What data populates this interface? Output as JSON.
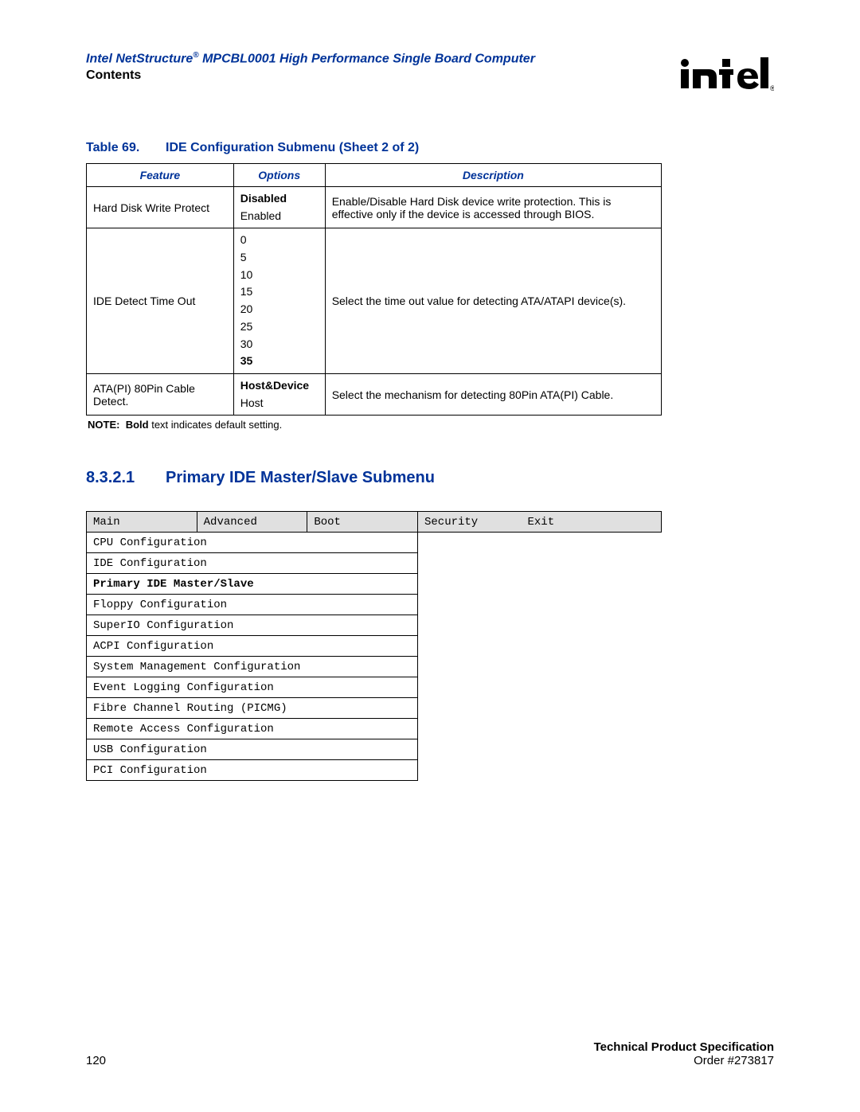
{
  "header": {
    "doc_title_prefix": "Intel NetStructure",
    "doc_title_suffix": " MPCBL0001 High Performance Single Board Computer",
    "contents_label": "Contents"
  },
  "table69": {
    "label": "Table 69.",
    "title": "IDE Configuration Submenu (Sheet 2 of 2)",
    "headers": {
      "feature": "Feature",
      "options": "Options",
      "description": "Description"
    },
    "rows": [
      {
        "feature": "Hard Disk Write Protect",
        "options": [
          {
            "text": "Disabled",
            "bold": true
          },
          {
            "text": "Enabled",
            "bold": false
          }
        ],
        "description": "Enable/Disable Hard Disk device write protection. This is effective only if the device is accessed through BIOS."
      },
      {
        "feature": "IDE Detect Time Out",
        "options": [
          {
            "text": "0",
            "bold": false
          },
          {
            "text": "5",
            "bold": false
          },
          {
            "text": "10",
            "bold": false
          },
          {
            "text": "15",
            "bold": false
          },
          {
            "text": "20",
            "bold": false
          },
          {
            "text": "25",
            "bold": false
          },
          {
            "text": "30",
            "bold": false
          },
          {
            "text": "35",
            "bold": true
          }
        ],
        "description": "Select the time out value for detecting ATA/ATAPI device(s)."
      },
      {
        "feature": "ATA(PI) 80Pin Cable Detect.",
        "options": [
          {
            "text": "Host&Device",
            "bold": true
          },
          {
            "text": "Host",
            "bold": false
          }
        ],
        "description": "Select the mechanism for detecting 80Pin ATA(PI) Cable."
      }
    ],
    "note_label": "NOTE:",
    "note_bold": "Bold",
    "note_rest": " text indicates default setting."
  },
  "section": {
    "number": "8.3.2.1",
    "title": "Primary IDE Master/Slave Submenu"
  },
  "bios": {
    "tabs": [
      "Main",
      "Advanced",
      "Boot",
      "Security",
      "Exit"
    ],
    "menu": [
      {
        "text": "CPU Configuration",
        "bold": false
      },
      {
        "text": "IDE Configuration",
        "bold": false
      },
      {
        "text": "Primary IDE Master/Slave",
        "bold": true
      },
      {
        "text": "Floppy Configuration",
        "bold": false
      },
      {
        "text": "SuperIO Configuration",
        "bold": false
      },
      {
        "text": "ACPI Configuration",
        "bold": false
      },
      {
        "text": "System Management Configuration",
        "bold": false
      },
      {
        "text": "Event Logging Configuration",
        "bold": false
      },
      {
        "text": "Fibre Channel Routing (PICMG)",
        "bold": false
      },
      {
        "text": "Remote Access Configuration",
        "bold": false
      },
      {
        "text": "USB Configuration",
        "bold": false
      },
      {
        "text": "PCI Configuration",
        "bold": false
      }
    ]
  },
  "footer": {
    "page": "120",
    "tps": "Technical Product Specification",
    "order": "Order #273817"
  }
}
